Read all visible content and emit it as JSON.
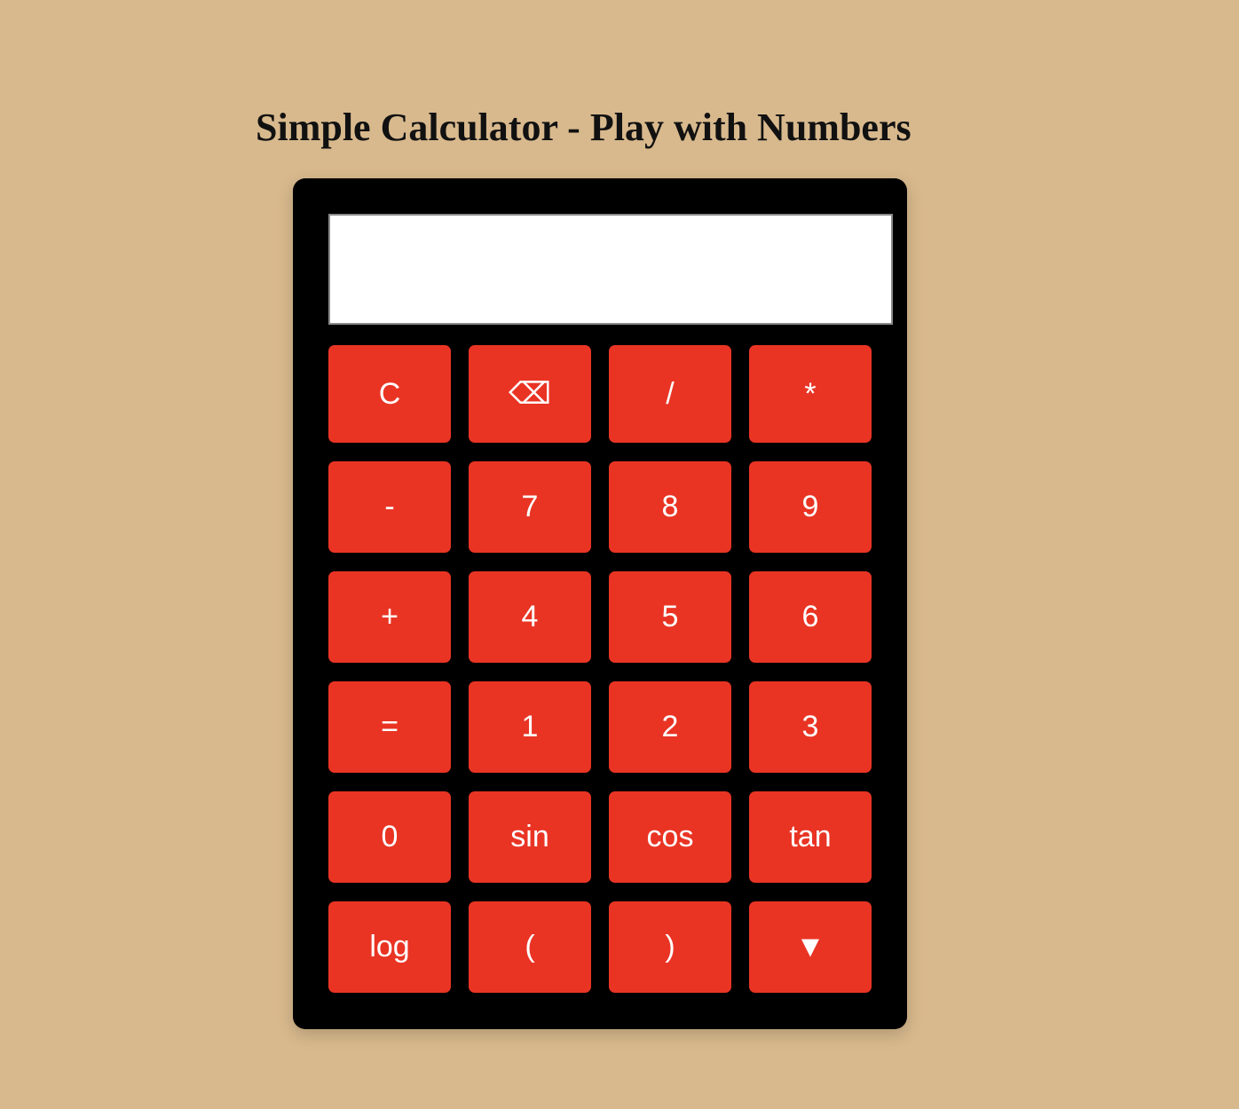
{
  "page": {
    "title": "Simple Calculator - Play with Numbers"
  },
  "display": {
    "value": ""
  },
  "keys": [
    [
      "C",
      "⌫",
      "/",
      "*"
    ],
    [
      "-",
      "7",
      "8",
      "9"
    ],
    [
      "+",
      "4",
      "5",
      "6"
    ],
    [
      "=",
      "1",
      "2",
      "3"
    ],
    [
      "0",
      "sin",
      "cos",
      "tan"
    ],
    [
      "log",
      "(",
      ")",
      "▼"
    ]
  ],
  "colors": {
    "background": "#d8b98d",
    "calculator_body": "#000000",
    "key": "#e93424",
    "key_text": "#ffffff",
    "display": "#ffffff"
  }
}
